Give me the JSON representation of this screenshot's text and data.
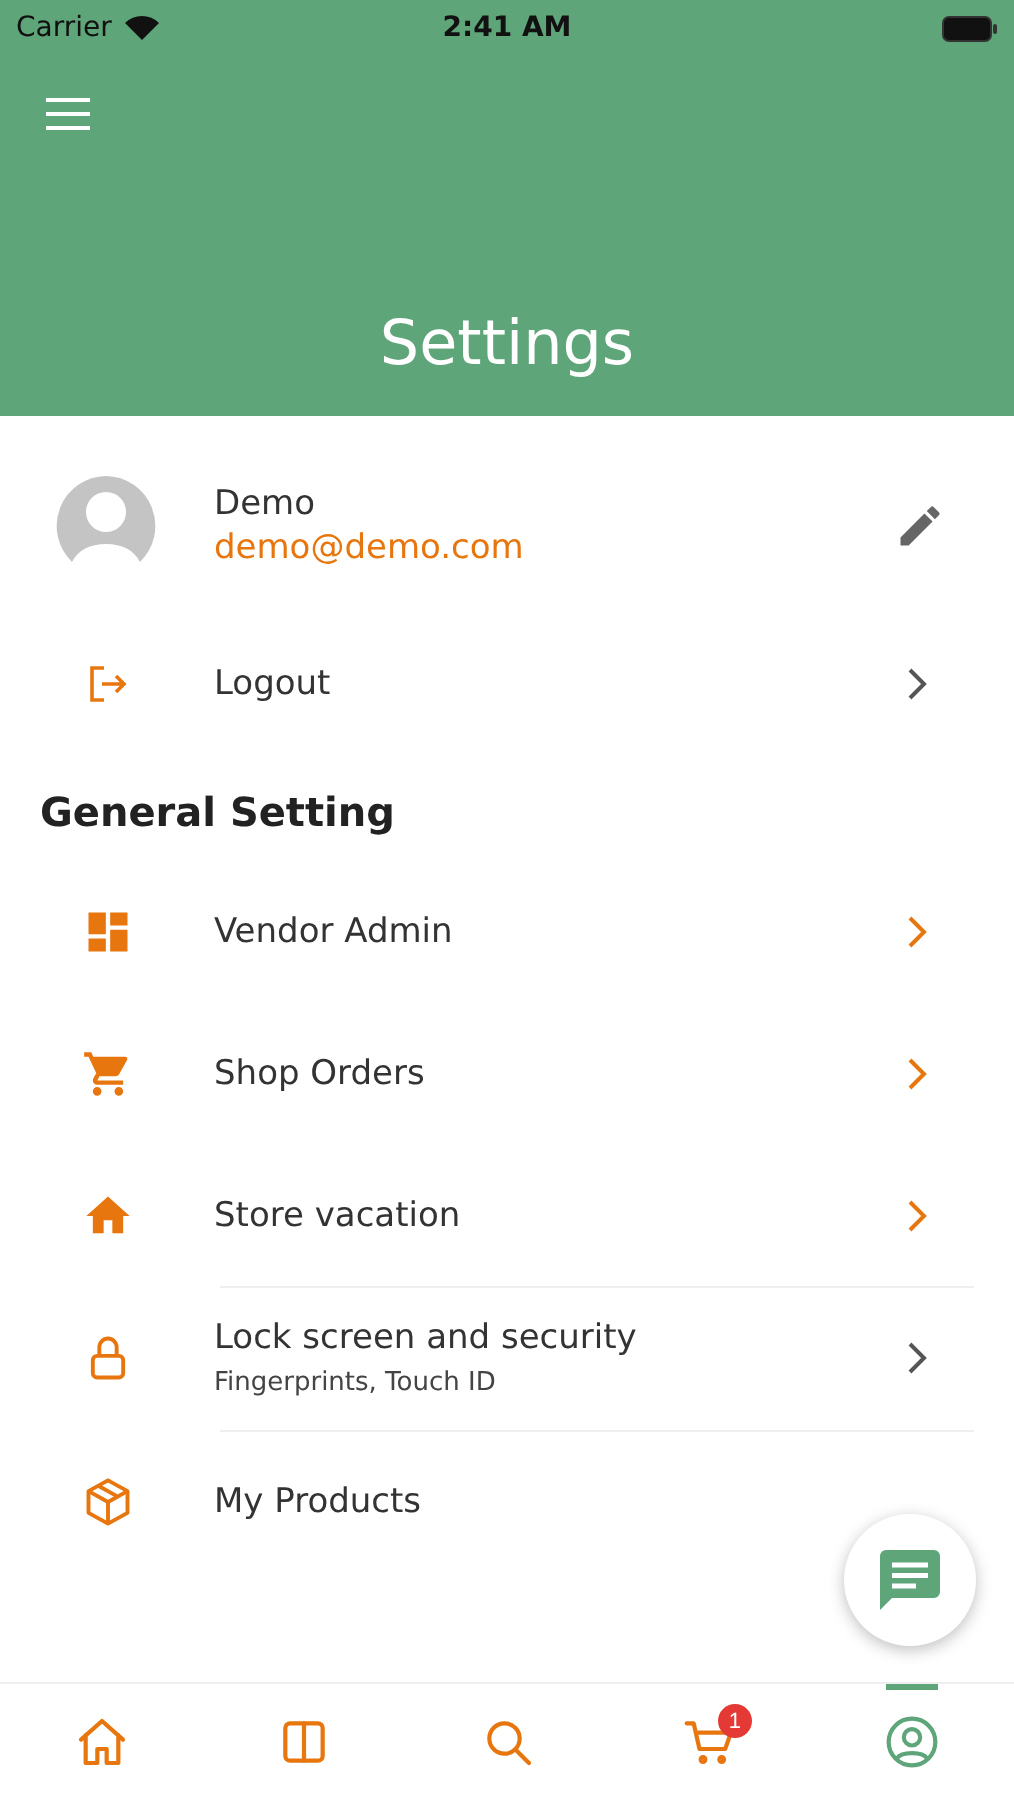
{
  "status_bar": {
    "carrier": "Carrier",
    "time": "2:41 AM"
  },
  "header": {
    "title": "Settings"
  },
  "profile": {
    "name": "Demo",
    "email": "demo@demo.com"
  },
  "logout": {
    "label": "Logout"
  },
  "section": {
    "title": "General Setting"
  },
  "items": [
    {
      "kind": "dashboard",
      "label": "Vendor Admin",
      "highlighted": true,
      "divider": false
    },
    {
      "kind": "cart",
      "label": "Shop Orders",
      "highlighted": true,
      "divider": false
    },
    {
      "kind": "house",
      "label": "Store vacation",
      "highlighted": true,
      "divider": false
    },
    {
      "kind": "lock",
      "label": "Lock screen and security",
      "subtitle": "Fingerprints, Touch ID",
      "highlighted": false,
      "divider": true
    },
    {
      "kind": "box",
      "label": "My Products",
      "divider": true
    }
  ],
  "tabs": [
    {
      "kind": "home",
      "selected": false
    },
    {
      "kind": "columns",
      "selected": false
    },
    {
      "kind": "search",
      "selected": false
    },
    {
      "kind": "cart",
      "selected": false,
      "badge": "1"
    },
    {
      "kind": "profile",
      "selected": true
    }
  ]
}
